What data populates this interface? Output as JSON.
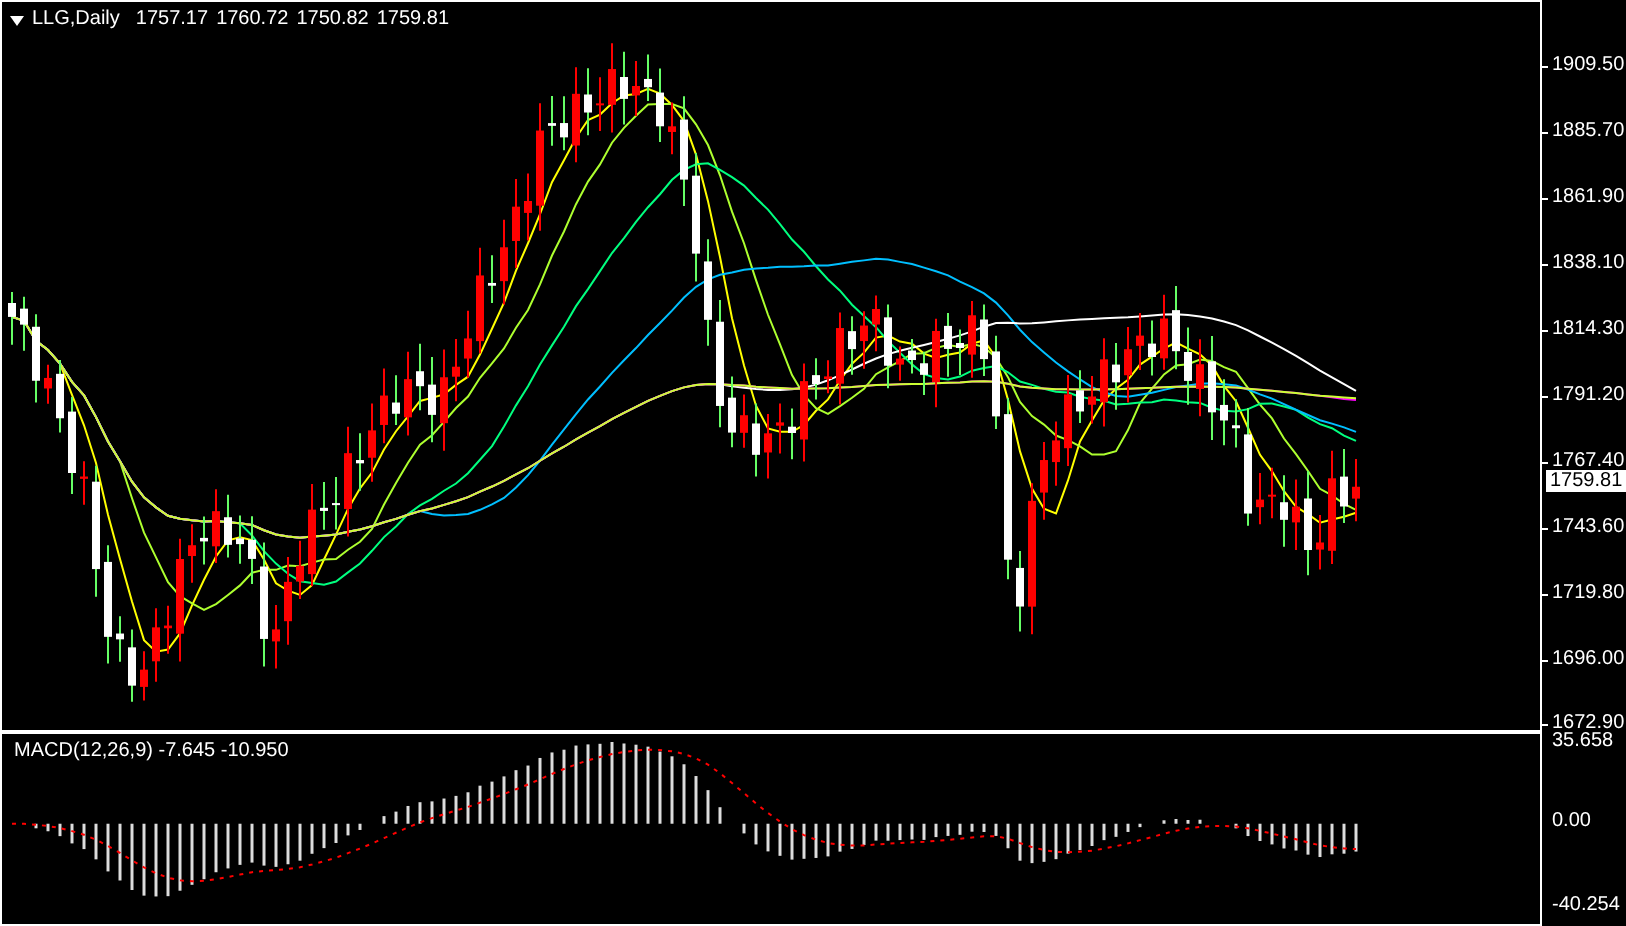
{
  "chart": {
    "symbol": "LLG,Daily",
    "ohlc": [
      "1757.17",
      "1760.72",
      "1750.82",
      "1759.81"
    ],
    "price_labels": [
      "1909.50",
      "1885.70",
      "1861.90",
      "1838.10",
      "1814.30",
      "1791.20",
      "1767.40",
      "1743.60",
      "1719.80",
      "1696.00",
      "1672.90"
    ],
    "current_price": "1759.81"
  },
  "macd": {
    "title": "MACD(12,26,9) -7.645 -10.950",
    "labels": [
      "35.658",
      "0.00",
      "-40.254"
    ]
  }
}
